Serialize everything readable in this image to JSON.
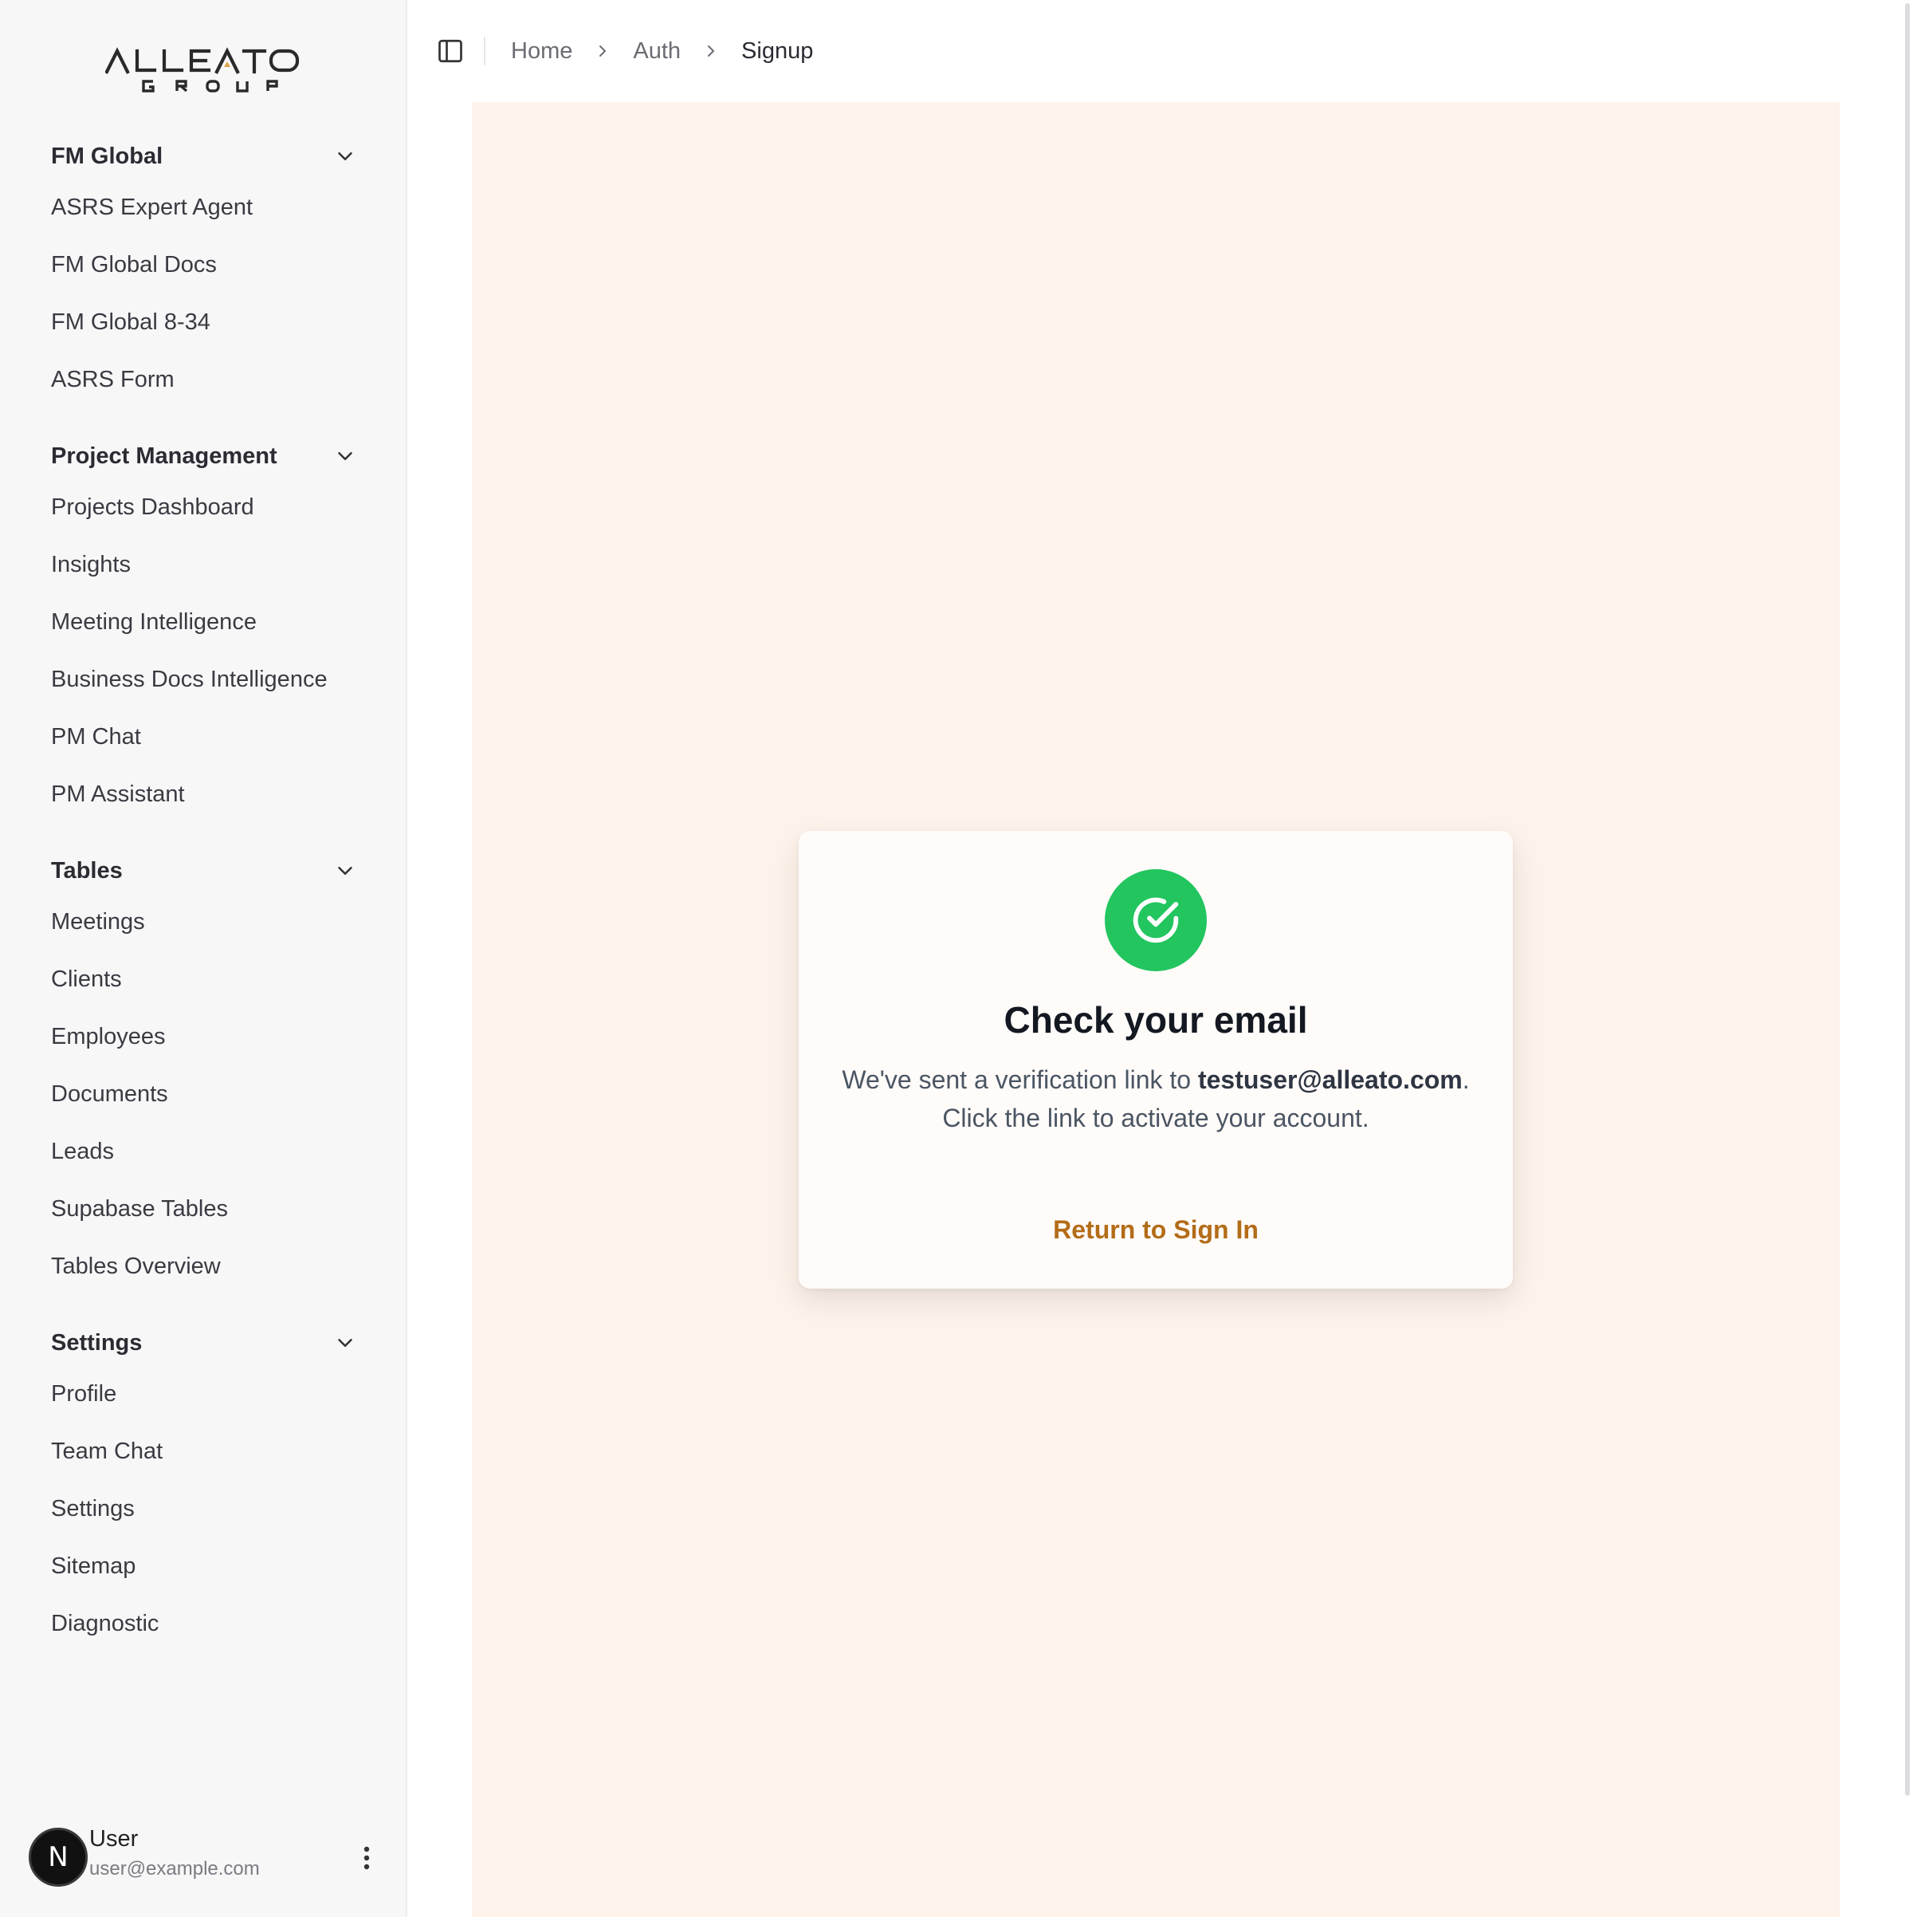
{
  "logo": {
    "word": "ALLEATO",
    "sub": "GROUP",
    "accent_color": "#e0a44a"
  },
  "sidebar": {
    "groups": [
      {
        "title": "FM Global",
        "items": [
          "ASRS Expert Agent",
          "FM Global Docs",
          "FM Global 8-34",
          "ASRS Form"
        ]
      },
      {
        "title": "Project Management",
        "items": [
          "Projects Dashboard",
          "Insights",
          "Meeting Intelligence",
          "Business Docs Intelligence",
          "PM Chat",
          "PM Assistant"
        ]
      },
      {
        "title": "Tables",
        "items": [
          "Meetings",
          "Clients",
          "Employees",
          "Documents",
          "Leads",
          "Supabase Tables",
          "Tables Overview"
        ]
      },
      {
        "title": "Settings",
        "items": [
          "Profile",
          "Team Chat",
          "Settings",
          "Sitemap",
          "Diagnostic"
        ]
      }
    ],
    "user": {
      "avatar_letter": "N",
      "name": "User",
      "email": "user@example.com"
    }
  },
  "breadcrumb": {
    "items": [
      "Home",
      "Auth",
      "Signup"
    ]
  },
  "card": {
    "title": "Check your email",
    "message_before": "We've sent a verification link to ",
    "email": "testuser@alleato.com",
    "message_after": ". Click the link to activate your account.",
    "link_label": "Return to Sign In",
    "success_color": "#22c55e",
    "link_color": "#b36c18"
  },
  "colors": {
    "panel_background": "#fdf3ea",
    "sidebar_background": "#f7f7f8"
  }
}
